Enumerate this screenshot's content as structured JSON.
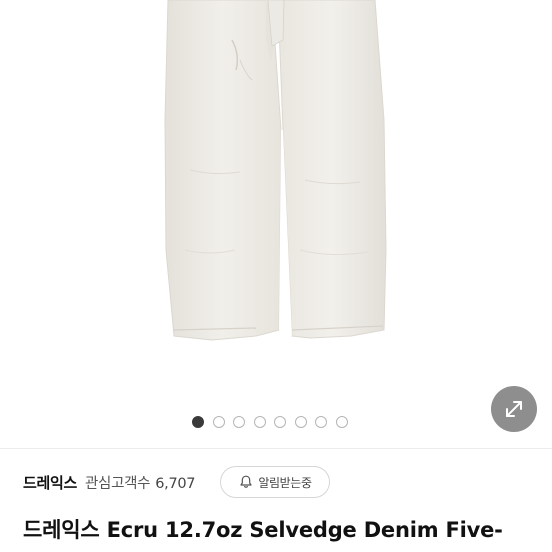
{
  "gallery": {
    "image_name": "ecru-selvedge-denim-jeans",
    "page_count": 8,
    "active_page": 1,
    "expand_icon": "expand-arrows-icon"
  },
  "brand": {
    "name": "드레익스",
    "interest_label": "관심고객수",
    "interest_count": "6,707"
  },
  "alert_button": {
    "icon": "bell-icon",
    "label": "알림받는중"
  },
  "product": {
    "title": "드레익스 Ecru 12.7oz Selvedge Denim Five-"
  },
  "colors": {
    "active_dot": "#3a3a3a",
    "inactive_dot_border": "#b5b5b5",
    "expand_button_bg": "#6e6e6e"
  }
}
